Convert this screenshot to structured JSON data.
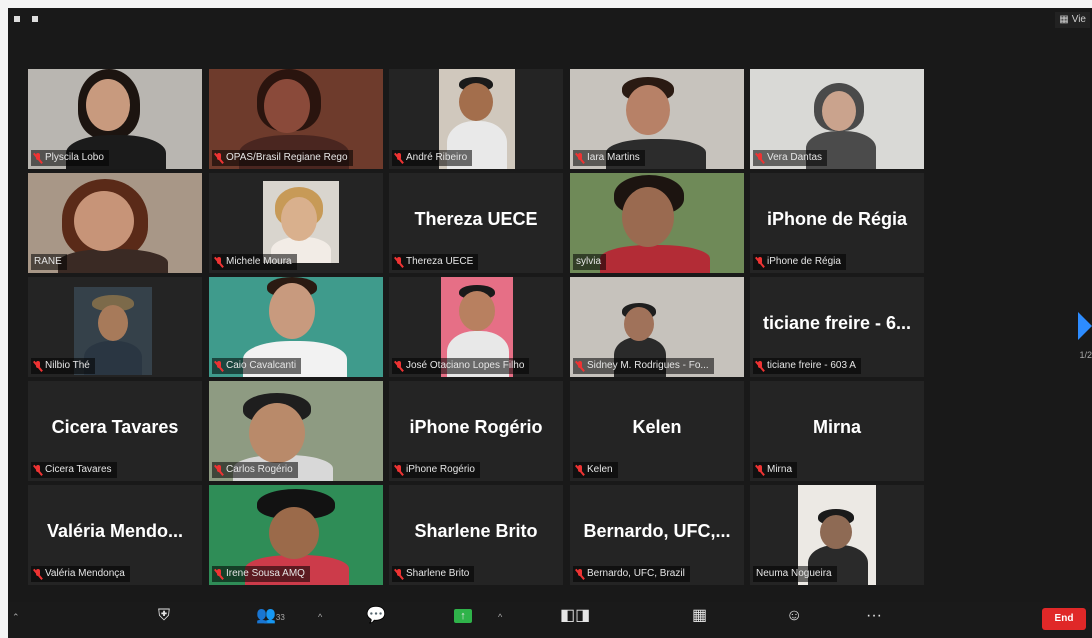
{
  "window": {
    "view_label": "Vie"
  },
  "tiles": [
    {
      "name": "Plyscila Lobo",
      "type": "video"
    },
    {
      "name": "OPAS/Brasil Regiane Rego",
      "type": "video"
    },
    {
      "name": "André Ribeiro",
      "type": "video"
    },
    {
      "name": "Iara Martins",
      "type": "video"
    },
    {
      "name": "Vera Dantas",
      "type": "video"
    },
    {
      "name": "RANE",
      "type": "video"
    },
    {
      "name": "Michele Moura",
      "type": "video"
    },
    {
      "name": "Thereza UECE",
      "display": "Thereza UECE",
      "type": "name"
    },
    {
      "name": "sylvia",
      "type": "video"
    },
    {
      "name": "iPhone de Régia",
      "display": "iPhone de Régia",
      "type": "name"
    },
    {
      "name": "Nilbio Thé",
      "type": "video"
    },
    {
      "name": "Caio Cavalcanti",
      "type": "video",
      "active": true
    },
    {
      "name": "José Otaciano Lopes Filho",
      "type": "video"
    },
    {
      "name": "Sidney M. Rodrigues - Fo...",
      "type": "video"
    },
    {
      "name": "ticiane freire - 603 A",
      "display": "ticiane freire - 6...",
      "type": "name"
    },
    {
      "name": "Cicera Tavares",
      "display": "Cicera Tavares",
      "type": "name"
    },
    {
      "name": "Carlos Rogério",
      "type": "video"
    },
    {
      "name": "iPhone Rogério",
      "display": "iPhone Rogério",
      "type": "name"
    },
    {
      "name": "Kelen",
      "display": "Kelen",
      "type": "name"
    },
    {
      "name": "Mirna",
      "display": "Mirna",
      "type": "name"
    },
    {
      "name": "Valéria Mendonça",
      "display": "Valéria  Mendo...",
      "type": "name"
    },
    {
      "name": "Irene Sousa AMQ",
      "type": "video"
    },
    {
      "name": "Sharlene Brito",
      "display": "Sharlene Brito",
      "type": "name"
    },
    {
      "name": "Bernardo, UFC, Brazil",
      "display": "Bernardo,  UFC,...",
      "type": "name"
    },
    {
      "name": "Neuma Nogueira",
      "type": "video"
    }
  ],
  "pager": {
    "label": "1/2"
  },
  "toolbar": {
    "participants_count": "33",
    "end_label": "End"
  },
  "colors": {
    "accent": "#2d8cff",
    "active_speaker": "#b8d45a",
    "end": "#e02828",
    "muted_mic": "#e33333"
  }
}
